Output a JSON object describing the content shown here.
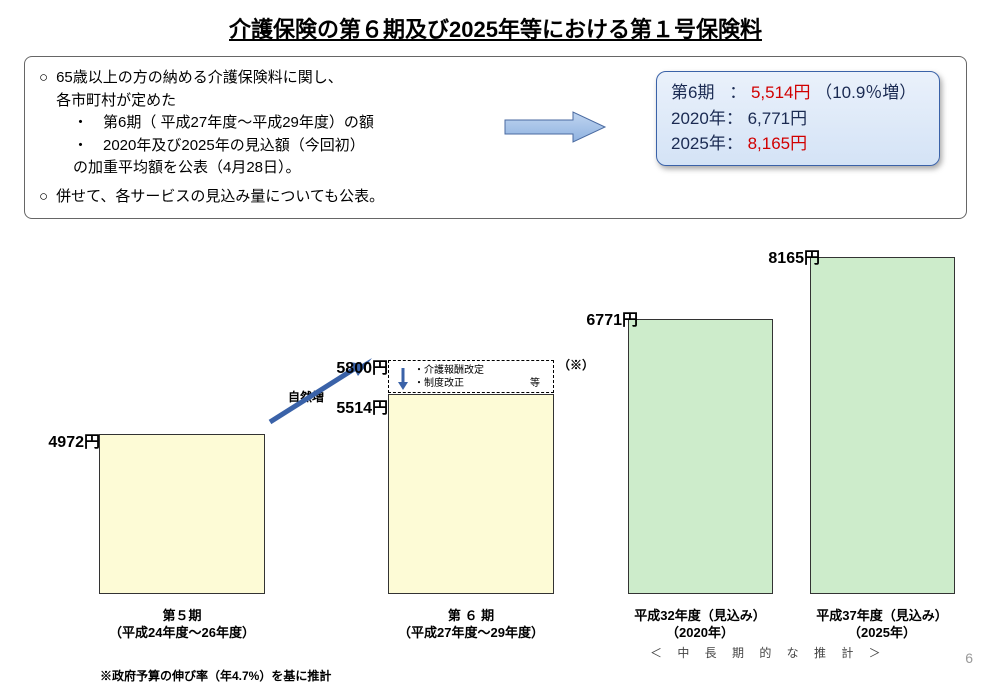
{
  "title": "介護保険の第６期及び2025年等における第１号保険料",
  "info": {
    "line1_lead": "65歳以上の方の納める介護保険料に関し、",
    "line1b": "各市町村が定めた",
    "line2": "・　第6期（ 平成27年度～平成29年度）の額",
    "line3": "・　2020年及び2025年の見込額（今回初）",
    "line4": "の加重平均額を公表（4月28日）。",
    "line5": "併せて、各サービスの見込み量についても公表。"
  },
  "callout": {
    "row1a": "第6期",
    "row1b": "：",
    "row1c": "5,514円",
    "row1d": "（10.9％増）",
    "row2a": "2020年：",
    "row2b": "6,771円",
    "row3a": "2025年：",
    "row3b": "8,165円"
  },
  "chart_data": {
    "type": "bar",
    "ylabel": "円",
    "series": [
      {
        "name": "第５期",
        "value": 4972,
        "label": "4972円",
        "color": "yellow",
        "xlabel_top": "第５期",
        "xlabel_bottom": "（平成24年度～26年度）"
      },
      {
        "name": "第６期",
        "value": 5514,
        "label": "5514円",
        "color": "yellow",
        "xlabel_top": "第 ６ 期",
        "xlabel_bottom": "（平成27年度～29年度）",
        "dashed_marker": 5800,
        "dashed_label": "5800円",
        "dashed_suffix": "（※）",
        "dashed_notes": [
          "・介護報酬改定",
          "・制度改正"
        ],
        "dashed_notes_suffix": "等"
      },
      {
        "name": "平成32年度",
        "value": 6771,
        "label": "6771円",
        "color": "green",
        "xlabel_top": "平成32年度（見込み）",
        "xlabel_bottom": "（2020年）"
      },
      {
        "name": "平成37年度",
        "value": 8165,
        "label": "8165円",
        "color": "green",
        "xlabel_top": "平成37年度（見込み）",
        "xlabel_bottom": "（2025年）"
      }
    ],
    "natural_increase_label": "自然増",
    "long_term_label": "＜ 中 長 期 的 な 推 計 ＞",
    "footnote": "※政府予算の伸び率（年4.7%）を基に推計"
  },
  "page_number": "6"
}
